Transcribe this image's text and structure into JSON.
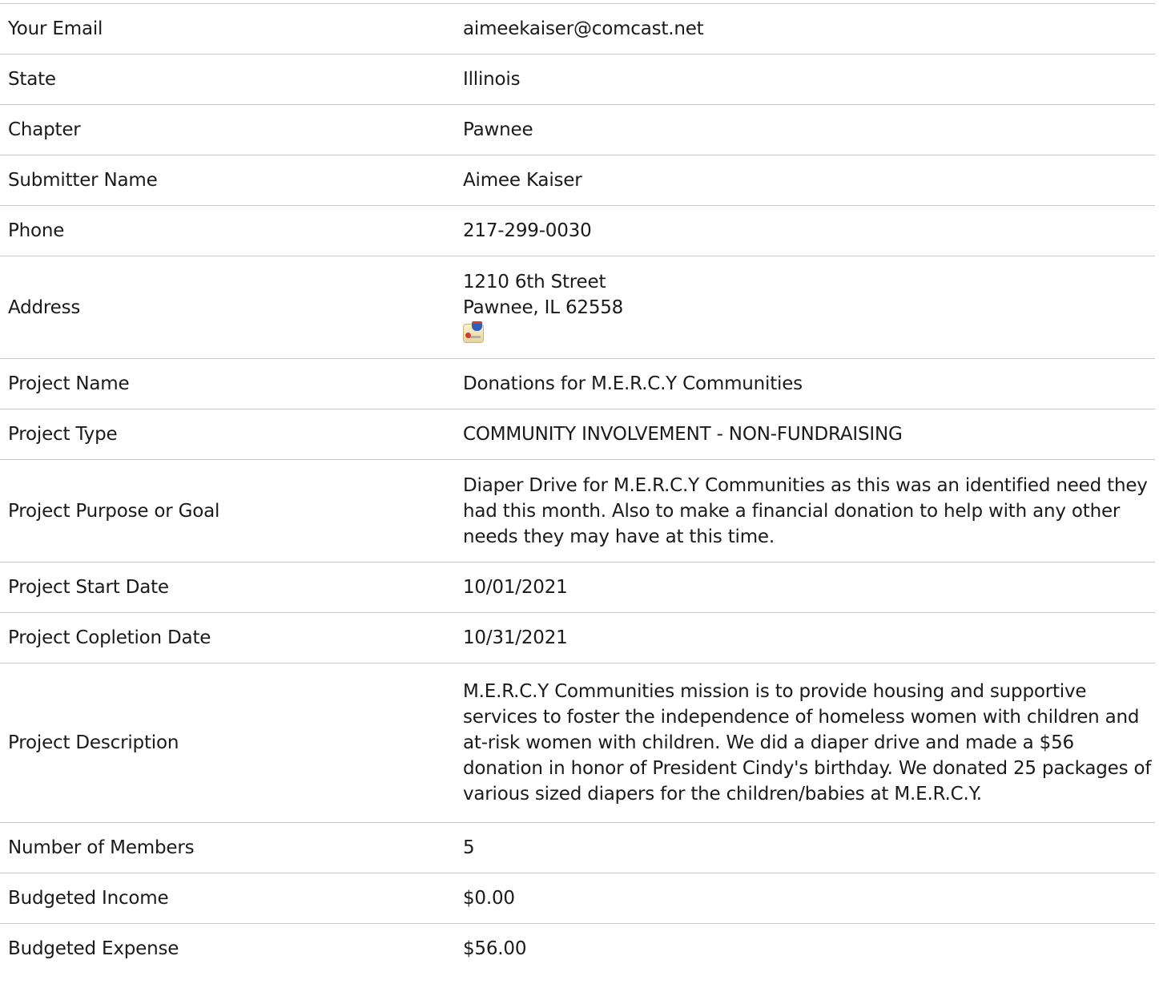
{
  "fields": {
    "email": {
      "label": "Your Email",
      "value": "aimeekaiser@comcast.net"
    },
    "state": {
      "label": "State",
      "value": "Illinois"
    },
    "chapter": {
      "label": "Chapter",
      "value": "Pawnee"
    },
    "submitter_name": {
      "label": "Submitter Name",
      "value": "Aimee Kaiser"
    },
    "phone": {
      "label": "Phone",
      "value": "217-299-0030"
    },
    "address": {
      "label": "Address",
      "line1": "1210 6th Street",
      "line2": "Pawnee, IL 62558",
      "map_icon": "map-icon"
    },
    "project_name": {
      "label": "Project Name",
      "value": "Donations for M.E.R.C.Y Communities"
    },
    "project_type": {
      "label": "Project Type",
      "value": "COMMUNITY INVOLVEMENT - NON-FUNDRAISING"
    },
    "project_purpose": {
      "label": "Project Purpose or Goal",
      "value": "Diaper Drive for M.E.R.C.Y Communities as this was an identified need they had this month. Also to make a financial donation to help with any other needs they may have at this time."
    },
    "project_start_date": {
      "label": "Project Start Date",
      "value": "10/01/2021"
    },
    "project_completion_date": {
      "label": "Project Copletion Date",
      "value": "10/31/2021"
    },
    "project_description": {
      "label": "Project Description",
      "value": "M.E.R.C.Y Communities mission is to provide housing and supportive services to foster the independence of homeless women with children and at-risk women with children. We did a diaper drive and made a $56 donation in honor of President Cindy's birthday. We donated 25 packages of various sized diapers for the children/babies at M.E.R.C.Y."
    },
    "number_of_members": {
      "label": "Number of Members",
      "value": "5"
    },
    "budgeted_income": {
      "label": "Budgeted Income",
      "value": "$0.00"
    },
    "budgeted_expense": {
      "label": "Budgeted Expense",
      "value": "$56.00"
    }
  }
}
